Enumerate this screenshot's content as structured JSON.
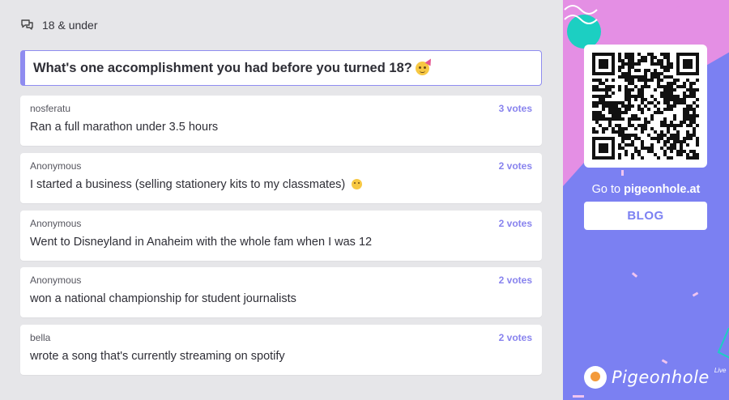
{
  "header": {
    "icon": "chat-bubbles-icon",
    "title": "18 & under"
  },
  "question": {
    "text": "What's one accomplishment you had before you turned 18?",
    "emoji": "party-face-emoji"
  },
  "answers": [
    {
      "author": "nosferatu",
      "votes": "3 votes",
      "text": "Ran a full marathon under 3.5 hours"
    },
    {
      "author": "Anonymous",
      "votes": "2 votes",
      "text": "I started a business (selling stationery kits to my classmates)",
      "emoji": "pleading-face-emoji"
    },
    {
      "author": "Anonymous",
      "votes": "2 votes",
      "text": "Went to Disneyland in Anaheim with the whole fam when I was 12"
    },
    {
      "author": "Anonymous",
      "votes": "2 votes",
      "text": "won a national championship for student journalists"
    },
    {
      "author": "bella",
      "votes": "2 votes",
      "text": "wrote a song that's currently streaming on spotify"
    }
  ],
  "sidebar": {
    "goto_prefix": "Go to",
    "goto_site": "pigeonhole.at",
    "blog_label": "BLOG",
    "brand_name": "Pigeonhole",
    "brand_suffix": "Live",
    "colors": {
      "background": "#7b80f2",
      "accent_pink": "#e48fe4",
      "accent_teal": "#1ccfc2",
      "votes": "#8883ee"
    }
  }
}
